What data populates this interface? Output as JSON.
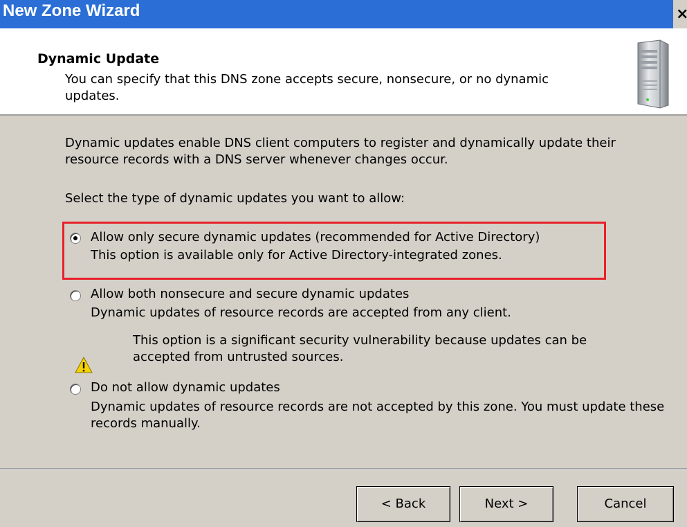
{
  "window": {
    "title": "New Zone Wizard",
    "close_glyph": "×"
  },
  "header": {
    "title": "Dynamic Update",
    "subtitle": "You can specify that this DNS zone accepts secure, nonsecure, or no dynamic updates.",
    "icon": "server-icon"
  },
  "body": {
    "intro": "Dynamic updates enable DNS client computers to register and dynamically update their resource records with a DNS server whenever changes occur.",
    "prompt": "Select the type of dynamic updates you want to allow:",
    "options": [
      {
        "label": "Allow only secure dynamic updates (recommended for Active Directory)",
        "description": "This option is available only for Active Directory-integrated zones.",
        "selected": true
      },
      {
        "label": "Allow both nonsecure and secure dynamic updates",
        "description": "Dynamic updates of resource records are accepted from any client.",
        "warning": "This option is a significant security vulnerability because updates can be accepted from untrusted sources.",
        "selected": false
      },
      {
        "label": "Do not allow dynamic updates",
        "description": "Dynamic updates of resource records are not accepted by this zone. You must update these records manually.",
        "selected": false
      }
    ]
  },
  "footer": {
    "back_label": "< Back",
    "next_label": "Next >",
    "cancel_label": "Cancel"
  },
  "colors": {
    "titlebar": "#2b6fd6",
    "highlight": "#e8202a",
    "dialog_bg": "#d4d0c8"
  }
}
